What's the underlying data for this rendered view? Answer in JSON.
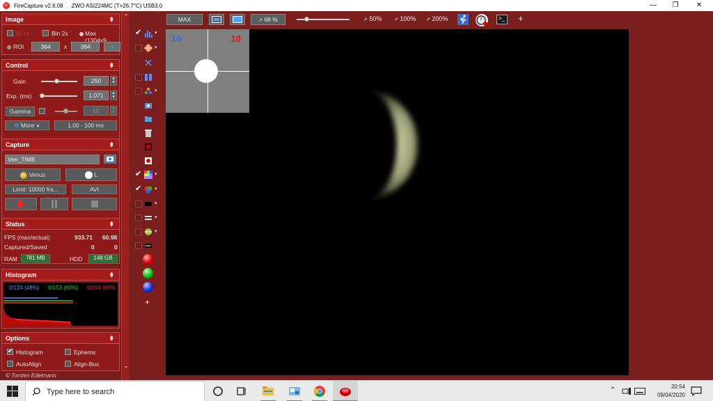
{
  "titlebar": {
    "app_title": "FireCapture v2.6.08",
    "camera_title": "ZWO ASI224MC (T=26.7°C) USB3.0",
    "minimize": "—",
    "restore": "❐",
    "close": "✕"
  },
  "image_section": {
    "title": "Image",
    "collapse": "⇞",
    "bin2x": "Bin 2x",
    "max_label": "Max (1304x9",
    "faded_label": "16 bit",
    "roi_label": "ROI",
    "roi_w": "384",
    "roi_x": "x",
    "roi_h": "384",
    "arrow": "➜"
  },
  "control_section": {
    "title": "Control",
    "collapse": "⇞",
    "gain_label": "Gain",
    "gain_value": "250",
    "exp_label": "Exp. (ms)",
    "exp_value": "1.071",
    "gamma_label": "Gamma",
    "gamma_value": "50",
    "more_label": "More",
    "range_label": "1.00 - 100 ms"
  },
  "capture_section": {
    "title": "Capture",
    "collapse": "⇞",
    "filename": "Ven_TIME",
    "object_label": "Venus",
    "filter_label": "L",
    "limit_label": "Limit: 10000 fra...",
    "format_label": "AVI"
  },
  "status_section": {
    "title": "Status",
    "collapse": "⇞",
    "fps_label": "FPS (max/actual)",
    "fps_max": "933.71",
    "fps_actual": "60.98",
    "captured_label": "Captured/Saved",
    "captured": "0",
    "saved": "0",
    "ram_label": "RAM",
    "ram_value": "781 MB",
    "hdd_label": "HDD",
    "hdd_value": "148 GB"
  },
  "histogram_section": {
    "title": "Histogram",
    "collapse": "⇞",
    "blue_text": "0/124 (48%)",
    "green_text": "0/153 (60%)",
    "red_text": "0/154 (60%",
    "colors": {
      "blue": "#5a8cff",
      "green": "#2ed12e",
      "red": "#ff2a2a"
    }
  },
  "options_section": {
    "title": "Options",
    "collapse": "⇞",
    "histogram_label": "Histogram",
    "ephems_label": "Ephems",
    "autoalign_label": "AutoAlign",
    "alignbox_label": "Align-Box"
  },
  "copyright": "© Torsten Edelmann",
  "toolbar": {
    "max_label": "MAX",
    "zoom_value": "68 %",
    "zoom_50": "50%",
    "zoom_100": "100%",
    "zoom_200": "200%",
    "add": "+"
  },
  "tools": {
    "add": "+",
    "icons": [
      "histogram-icon",
      "crosshair-icon",
      "scissors-icon",
      "settings-icon",
      "move-icon",
      "snapshot-icon",
      "folder-icon",
      "trash-icon",
      "record-frame-icon",
      "target-icon",
      "color-grid-icon",
      "color-wheel-icon",
      "black-rect-icon",
      "overlay-icon",
      "planet-icon",
      "text-icon",
      "red-ball-icon",
      "green-ball-icon",
      "blue-ball-icon"
    ]
  },
  "focus_assist": {
    "left_number": "10",
    "right_number": "10"
  },
  "taskbar": {
    "search_placeholder": "Type here to search",
    "time": "20:54",
    "date": "09/04/2020"
  }
}
